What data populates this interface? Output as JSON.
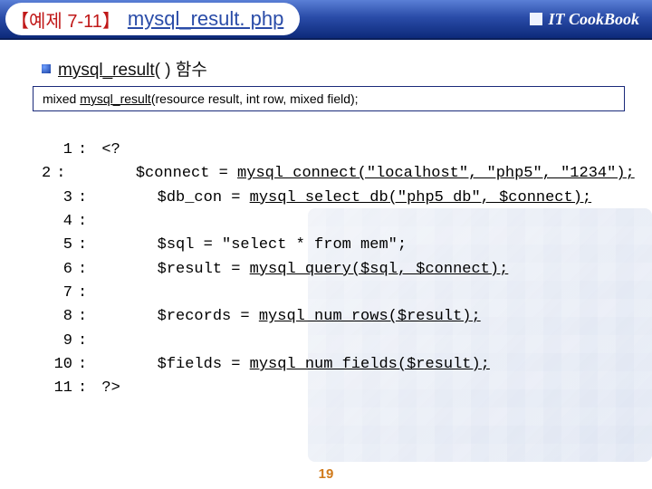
{
  "title": {
    "tag": "【예제 7-11】",
    "text": "mysql_result. php"
  },
  "brand": "IT CookBook",
  "bullet": {
    "fn": "mysql_result",
    "suffix": "( ) 함수"
  },
  "proto": {
    "prefix": "mixed ",
    "fn": "mysql_result",
    "suffix": "(resource result, int row, mixed field);"
  },
  "code": [
    {
      "n": "1",
      "plain": "<?",
      "u": ""
    },
    {
      "n": "2",
      "plain": "      $connect = ",
      "u": "mysql_connect(\"localhost\", \"php5\", \"1234\");"
    },
    {
      "n": "3",
      "plain": "      $db_con = ",
      "u": "mysql_select_db(\"php5_db\", $connect);"
    },
    {
      "n": "4",
      "plain": "",
      "u": ""
    },
    {
      "n": "5",
      "plain": "      $sql = \"select * from mem\";",
      "u": ""
    },
    {
      "n": "6",
      "plain": "      $result = ",
      "u": "mysql_query($sql, $connect);"
    },
    {
      "n": "7",
      "plain": "",
      "u": ""
    },
    {
      "n": "8",
      "plain": "      $records = ",
      "u": "mysql_num_rows($result);"
    },
    {
      "n": "9",
      "plain": "",
      "u": ""
    },
    {
      "n": "10",
      "plain": "      $fields = ",
      "u": "mysql_num_fields($result);"
    },
    {
      "n": "11",
      "plain": "?>",
      "u": ""
    }
  ],
  "page": "19"
}
